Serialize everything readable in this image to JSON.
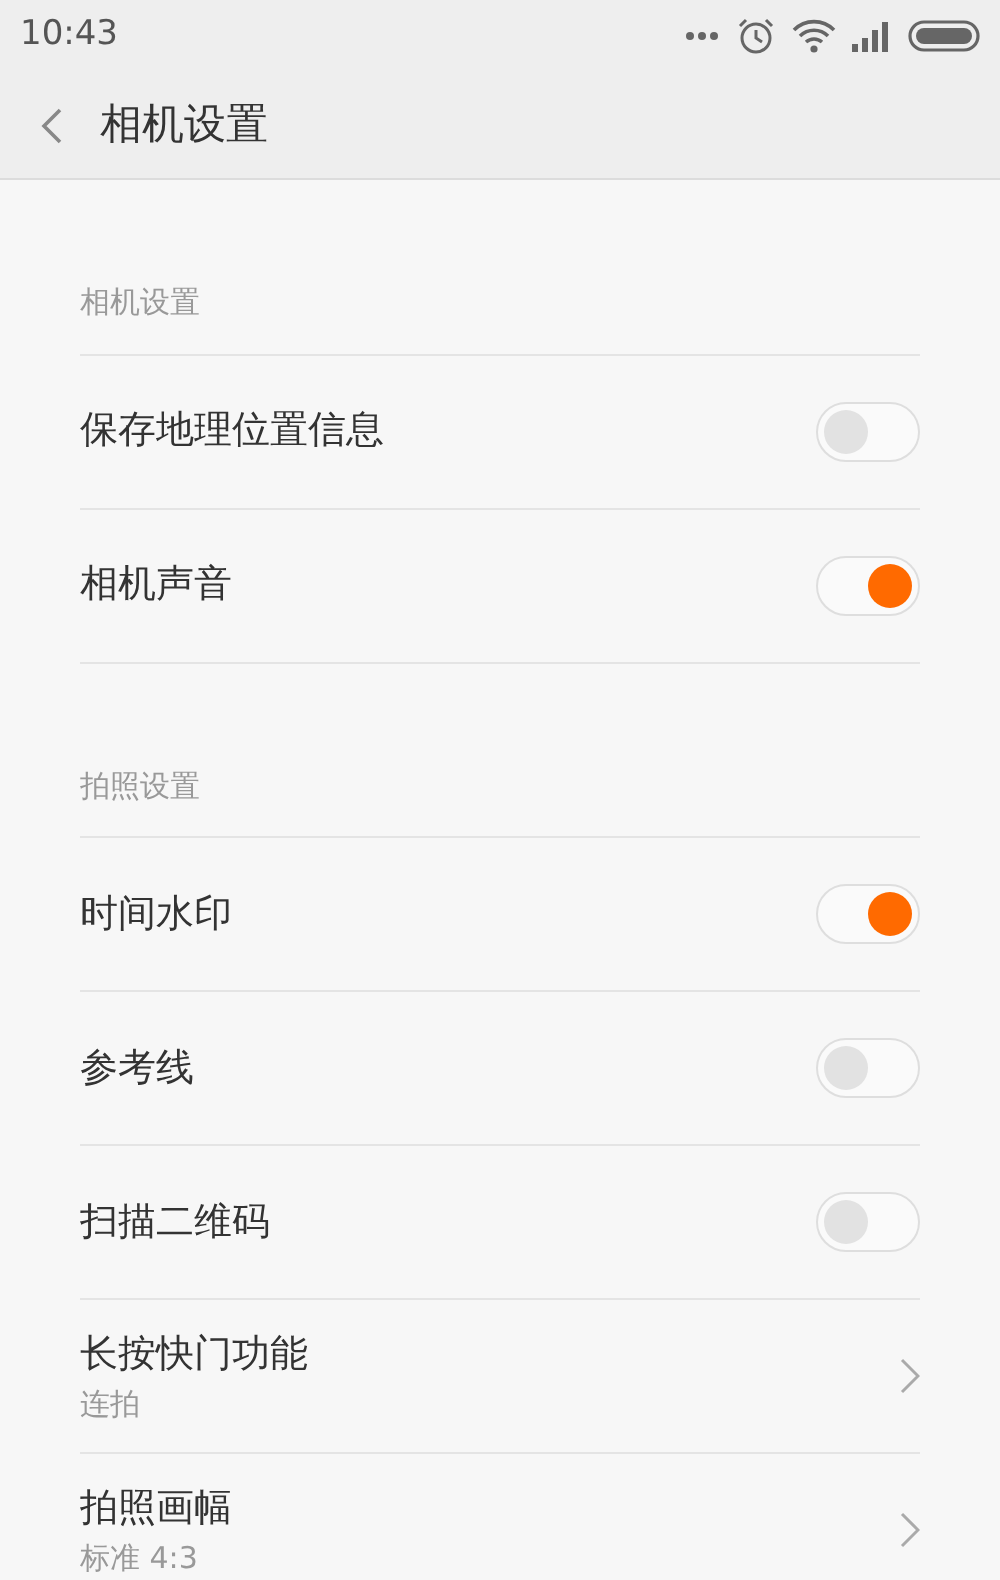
{
  "status_bar": {
    "time": "10:43"
  },
  "header": {
    "title": "相机设置"
  },
  "sections": [
    {
      "title": "相机设置",
      "items": [
        {
          "kind": "toggle",
          "label": "保存地理位置信息",
          "on": false
        },
        {
          "kind": "toggle",
          "label": "相机声音",
          "on": true
        }
      ]
    },
    {
      "title": "拍照设置",
      "items": [
        {
          "kind": "toggle",
          "label": "时间水印",
          "on": true
        },
        {
          "kind": "toggle",
          "label": "参考线",
          "on": false
        },
        {
          "kind": "toggle",
          "label": "扫描二维码",
          "on": false
        },
        {
          "kind": "link",
          "label": "长按快门功能",
          "value": "连拍"
        },
        {
          "kind": "link",
          "label": "拍照画幅",
          "value": "标准 4:3"
        }
      ]
    }
  ]
}
